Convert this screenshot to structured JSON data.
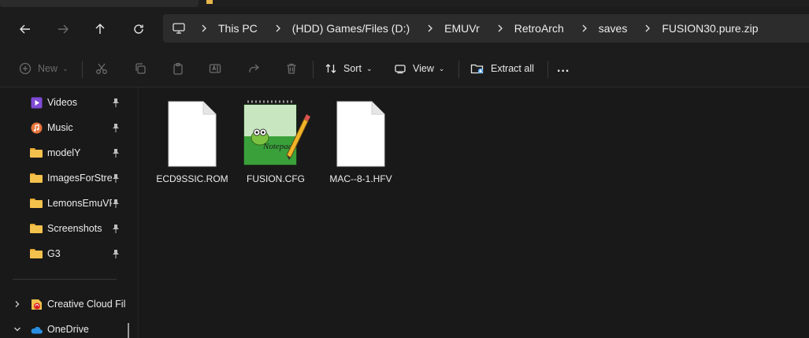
{
  "nav": {
    "back_icon": "arrow-left-icon",
    "forward_icon": "arrow-right-icon",
    "up_icon": "arrow-up-icon",
    "refresh_icon": "refresh-icon"
  },
  "breadcrumb": {
    "root_icon": "monitor-icon",
    "items": [
      "This PC",
      "(HDD) Games/Files (D:)",
      "EMUVr",
      "RetroArch",
      "saves",
      "FUSION30.pure.zip"
    ]
  },
  "toolbar": {
    "new_label": "New",
    "sort_label": "Sort",
    "view_label": "View",
    "extract_label": "Extract all",
    "more_label": "..."
  },
  "sidebar": {
    "items": [
      {
        "label": "Videos",
        "icon": "videos-icon",
        "pinned": true
      },
      {
        "label": "Music",
        "icon": "music-icon",
        "pinned": true
      },
      {
        "label": "modelY",
        "icon": "folder-icon",
        "pinned": true
      },
      {
        "label": "ImagesForStrea",
        "icon": "folder-icon",
        "pinned": true
      },
      {
        "label": "LemonsEmuVR",
        "icon": "folder-icon",
        "pinned": true
      },
      {
        "label": "Screenshots",
        "icon": "folder-icon",
        "pinned": true
      },
      {
        "label": "G3",
        "icon": "folder-icon",
        "pinned": true
      }
    ],
    "locations": [
      {
        "label": "Creative Cloud Files",
        "icon": "creative-cloud-icon"
      },
      {
        "label": "OneDrive",
        "icon": "onedrive-icon"
      }
    ]
  },
  "files": [
    {
      "name": "ECD9SSIC.ROM",
      "icon": "blank-file-icon"
    },
    {
      "name": "FUSION.CFG",
      "icon": "notepad-plus-plus-icon"
    },
    {
      "name": "MAC--8-1.HFV",
      "icon": "blank-file-icon"
    }
  ],
  "colors": {
    "background": "#191919",
    "addressbar": "#2c2c2c",
    "folder": "#f3c24c",
    "accent": "#4aa3f0"
  }
}
